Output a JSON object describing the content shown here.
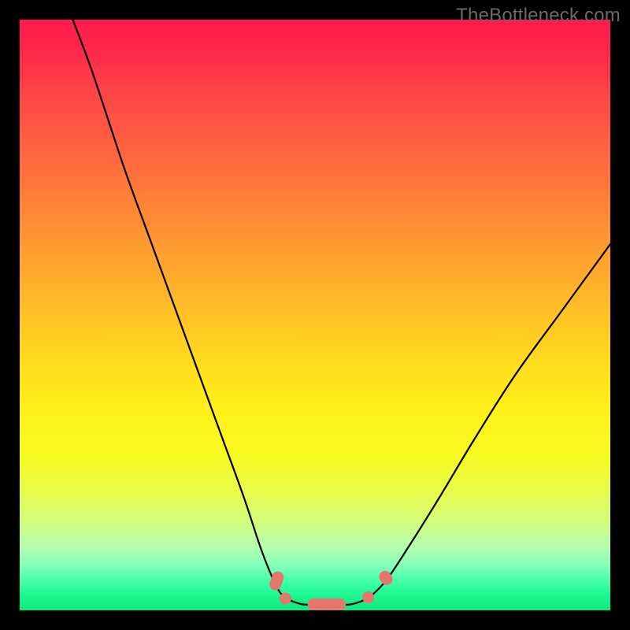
{
  "watermark": "TheBottleneck.com",
  "chart_data": {
    "type": "line",
    "title": "",
    "xlabel": "",
    "ylabel": "",
    "ylim": [
      0,
      100
    ],
    "xlim": [
      0,
      100
    ],
    "series": [
      {
        "name": "left-branch",
        "x": [
          9,
          12,
          15,
          18,
          22,
          26,
          30,
          34,
          38,
          41,
          43.5,
          45
        ],
        "y": [
          100,
          92,
          83,
          74,
          63,
          52,
          41,
          30,
          19,
          10,
          4,
          2
        ]
      },
      {
        "name": "floor",
        "x": [
          45,
          48,
          52,
          56,
          59
        ],
        "y": [
          2,
          1,
          1,
          1,
          2
        ]
      },
      {
        "name": "right-branch",
        "x": [
          59,
          62,
          66,
          71,
          77,
          84,
          92,
          100
        ],
        "y": [
          2,
          5,
          11,
          19,
          29,
          40,
          51,
          62
        ]
      }
    ],
    "markers": [
      {
        "shape": "capsule",
        "cx": 43.5,
        "cy": 5,
        "angle": 70,
        "len": 6.5,
        "r": 2.0
      },
      {
        "shape": "capsule",
        "cx": 45.0,
        "cy": 2.0,
        "angle": 55,
        "len": 4.0,
        "r": 2.0
      },
      {
        "shape": "capsule",
        "cx": 52.0,
        "cy": 1.0,
        "angle": 0,
        "len": 13,
        "r": 2.0
      },
      {
        "shape": "capsule",
        "cx": 59.0,
        "cy": 2.2,
        "angle": -40,
        "len": 4.0,
        "r": 2.0
      },
      {
        "shape": "capsule",
        "cx": 62.0,
        "cy": 5.5,
        "angle": -55,
        "len": 5.0,
        "r": 2.0
      }
    ],
    "colors": {
      "curve": "#000000",
      "marker": "#e4766d"
    }
  }
}
